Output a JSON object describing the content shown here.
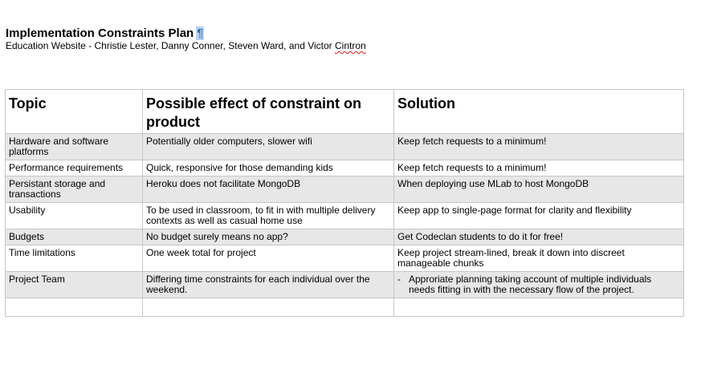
{
  "document": {
    "title": "Implementation Constraints Plan",
    "pilcrow": "¶",
    "subtitle_prefix": "Education Website - Christie Lester, Danny Conner, Steven Ward, and Victor ",
    "subtitle_last": "Cintron"
  },
  "table": {
    "headers": [
      "Topic",
      "Possible effect of constraint on product",
      "Solution"
    ],
    "rows": [
      {
        "topic": "Hardware and software platforms",
        "effect": " Potentially older computers, slower wifi",
        "solution": "Keep fetch requests to a minimum!"
      },
      {
        "topic": "Performance requirements",
        "effect": "Quick, responsive for those demanding kids",
        "solution": "Keep fetch requests to a minimum!"
      },
      {
        "topic": "Persistant storage and transactions",
        "effect": "Heroku does not facilitate MongoDB",
        "solution": "When deploying use MLab to host MongoDB"
      },
      {
        "topic": "Usability",
        "effect": "To be used in classroom, to fit in with multiple delivery contexts as well as casual home use",
        "solution": "Keep app to single-page format for clarity and flexibility"
      },
      {
        "topic": "Budgets",
        "effect": "No budget surely means no app?",
        "solution": "Get Codeclan students to do it for free!"
      },
      {
        "topic": "Time limitations",
        "effect": "One week total for project",
        "solution": "Keep project stream-lined, break it down into discreet manageable chunks"
      },
      {
        "topic": "Project Team",
        "effect": "Differing time constraints for each individual over the weekend.",
        "solution_bullet": "-",
        "solution": "Approriate planning taking account of multiple individuals needs fitting in with the necessary flow of the project."
      }
    ]
  }
}
